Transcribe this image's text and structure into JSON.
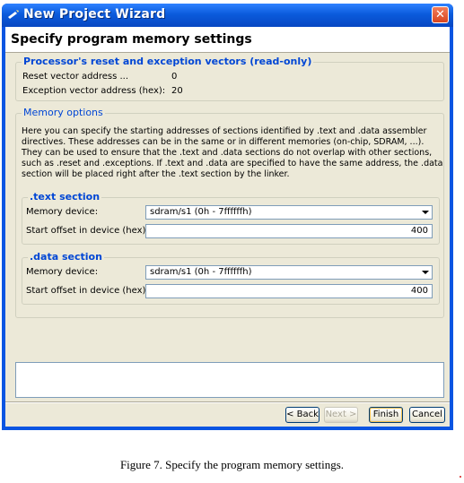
{
  "window": {
    "title": "New Project Wizard",
    "close_glyph": "✕",
    "icon": "wizard-wand-icon",
    "accent_color": "#0a55e2"
  },
  "header": {
    "title": "Specify program memory settings"
  },
  "vectors_group": {
    "legend": "Processor's reset and exception vectors (read-only)",
    "reset_label": "Reset vector address ...",
    "reset_value": "0",
    "exception_label": "Exception vector address (hex):",
    "exception_value": "20"
  },
  "memory_options": {
    "legend": "Memory options",
    "description": "Here you can specify the starting addresses of sections identified by .text and .data assembler directives. These addresses can be in the same or in different memories (on-chip, SDRAM, ...). They can be used to ensure that the .text and .data sections do not overlap with other sections, such as .reset and .exceptions. If .text and .data are specified to have the same address, the .data section will be placed right after the .text section by the linker.",
    "text_section": {
      "legend": ".text section",
      "device_label": "Memory device:",
      "device_value": "sdram/s1 (0h - 7ffffffh)",
      "offset_label": "Start offset in device (hex):",
      "offset_value": "400"
    },
    "data_section": {
      "legend": ".data section",
      "device_label": "Memory device:",
      "device_value": "sdram/s1 (0h - 7ffffffh)",
      "offset_label": "Start offset in device (hex):",
      "offset_value": "400"
    }
  },
  "buttons": {
    "back": "< Back",
    "next": "Next >",
    "finish": "Finish",
    "cancel": "Cancel"
  },
  "caption": "Figure 7. Specify the program memory settings."
}
